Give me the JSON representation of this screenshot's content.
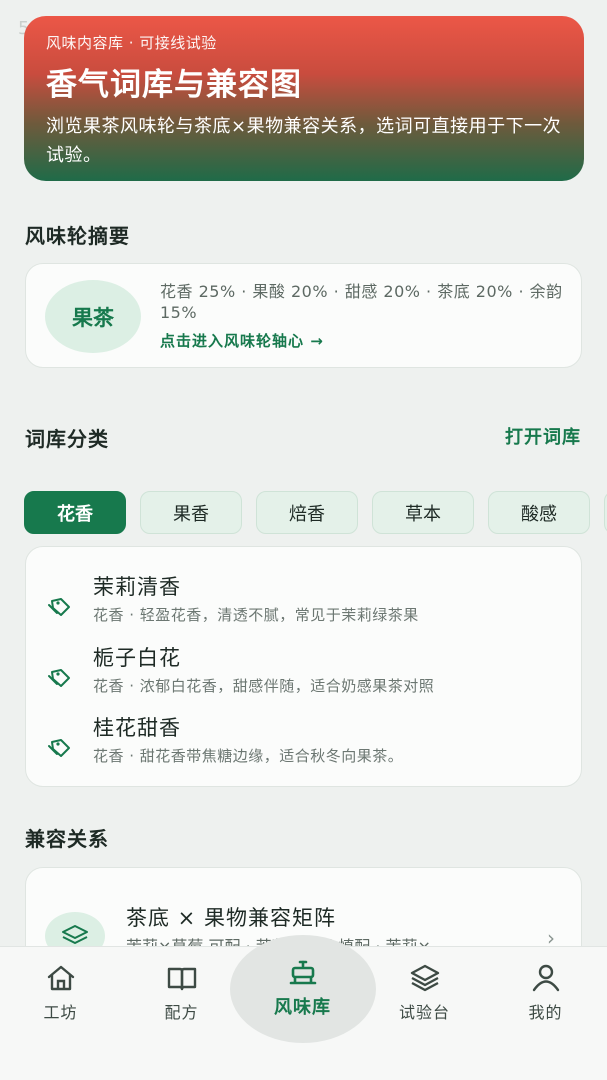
{
  "status": {
    "time": "5"
  },
  "hero": {
    "eyebrow": "风味内容库 · 可接线试验",
    "title": "香气词库与兼容图",
    "description": "浏览果茶风味轮与茶底×果物兼容关系，选词可直接用于下一次试验。"
  },
  "wheel": {
    "section_title": "风味轮摘要",
    "badge": "果茶",
    "summary": "花香 25% · 果酸 20% · 甜感 20% · 茶底 20% · 余韵 15%",
    "link": "点击进入风味轮轴心 →"
  },
  "library": {
    "section_title": "词库分类",
    "open_label": "打开词库",
    "chips": [
      {
        "label": "花香",
        "active": true
      },
      {
        "label": "果香",
        "active": false
      },
      {
        "label": "焙香",
        "active": false
      },
      {
        "label": "草本",
        "active": false
      },
      {
        "label": "酸感",
        "active": false
      }
    ],
    "items": [
      {
        "name": "茉莉清香",
        "desc": "花香 · 轻盈花香，清透不腻，常见于茉莉绿茶果"
      },
      {
        "name": "栀子白花",
        "desc": "花香 · 浓郁白花香，甜感伴随，适合奶感果茶对照"
      },
      {
        "name": "桂花甜香",
        "desc": "花香 · 甜花香带焦糖边缘，适合秋冬向果茶。"
      }
    ]
  },
  "compat": {
    "section_title": "兼容关系",
    "title": "茶底 × 果物兼容矩阵",
    "desc": "茉莉×草莓 可配 · 茉莉×青提 慎配 · 茉莉×",
    "icon": "layers-icon"
  },
  "tabbar": {
    "tabs": [
      {
        "label": "工坊",
        "icon": "home-icon",
        "active": false
      },
      {
        "label": "配方",
        "icon": "book-icon",
        "active": false
      },
      {
        "label": "风味库",
        "icon": "teapot-icon",
        "active": true
      },
      {
        "label": "试验台",
        "icon": "layers-icon",
        "active": false
      },
      {
        "label": "我的",
        "icon": "user-icon",
        "active": false
      }
    ]
  },
  "colors": {
    "accent": "#17794d",
    "hero_top": "#ec5747",
    "hero_bottom": "#1f6b48"
  }
}
